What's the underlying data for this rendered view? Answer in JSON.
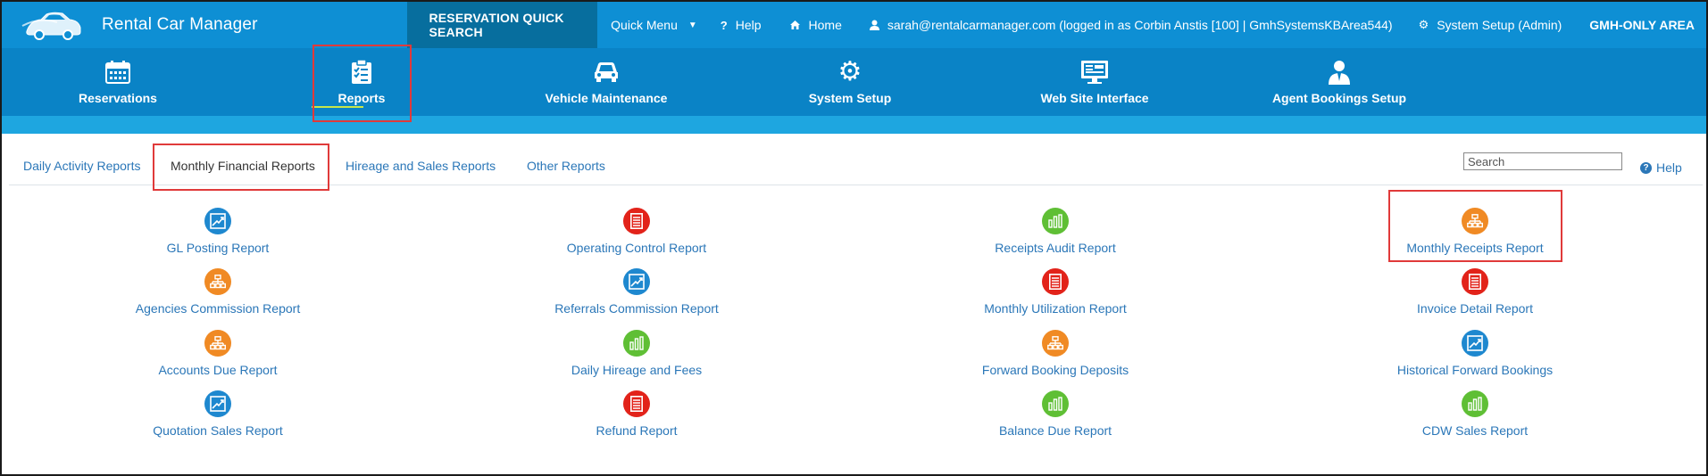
{
  "app": {
    "title": "Rental Car Manager"
  },
  "topnav": {
    "quick_search": "RESERVATION QUICK SEARCH",
    "quick_menu": "Quick Menu",
    "help": "Help",
    "home": "Home",
    "user": "sarah@rentalcarmanager.com (logged in as Corbin Anstis [100] | GmhSystemsKBArea544)",
    "system_setup": "System Setup (Admin)",
    "gmh_only": "GMH-ONLY AREA"
  },
  "modules": [
    {
      "label": "Reservations",
      "icon": "calendar-icon"
    },
    {
      "label": "Reports",
      "icon": "clipboard-icon"
    },
    {
      "label": "Vehicle Maintenance",
      "icon": "car-icon"
    },
    {
      "label": "System Setup",
      "icon": "gear-icon"
    },
    {
      "label": "Web Site Interface",
      "icon": "monitor-icon"
    },
    {
      "label": "Agent Bookings Setup",
      "icon": "agent-icon"
    }
  ],
  "tabs": [
    {
      "label": "Daily Activity Reports"
    },
    {
      "label": "Monthly Financial Reports",
      "active": true
    },
    {
      "label": "Hireage and Sales Reports"
    },
    {
      "label": "Other Reports"
    }
  ],
  "search": {
    "placeholder": "Search",
    "value": ""
  },
  "help_label": "Help",
  "colors": {
    "blue": "#1e88cf",
    "orange": "#f08a24",
    "red": "#e2231a",
    "green": "#5fbf35",
    "accent": "#0e8fd4"
  },
  "reports": [
    [
      {
        "label": "GL Posting Report",
        "color": "blue",
        "icon": "chart-icon"
      },
      {
        "label": "Agencies Commission Report",
        "color": "orange",
        "icon": "hierarchy-icon"
      },
      {
        "label": "Accounts Due Report",
        "color": "orange",
        "icon": "hierarchy-icon"
      },
      {
        "label": "Quotation Sales Report",
        "color": "blue",
        "icon": "chart-icon"
      }
    ],
    [
      {
        "label": "Operating Control Report",
        "color": "red",
        "icon": "document-icon"
      },
      {
        "label": "Referrals Commission Report",
        "color": "blue",
        "icon": "chart-icon"
      },
      {
        "label": "Daily Hireage and Fees",
        "color": "green",
        "icon": "bar-chart-icon"
      },
      {
        "label": "Refund Report",
        "color": "red",
        "icon": "document-icon"
      }
    ],
    [
      {
        "label": "Receipts Audit Report",
        "color": "green",
        "icon": "bar-chart-icon"
      },
      {
        "label": "Monthly Utilization Report",
        "color": "red",
        "icon": "document-icon"
      },
      {
        "label": "Forward Booking Deposits",
        "color": "orange",
        "icon": "hierarchy-icon"
      },
      {
        "label": "Balance Due Report",
        "color": "green",
        "icon": "bar-chart-icon"
      }
    ],
    [
      {
        "label": "Monthly Receipts Report",
        "color": "orange",
        "icon": "hierarchy-icon"
      },
      {
        "label": "Invoice Detail Report",
        "color": "red",
        "icon": "document-icon"
      },
      {
        "label": "Historical Forward Bookings",
        "color": "blue",
        "icon": "chart-icon"
      },
      {
        "label": "CDW Sales Report",
        "color": "green",
        "icon": "bar-chart-icon"
      }
    ]
  ]
}
